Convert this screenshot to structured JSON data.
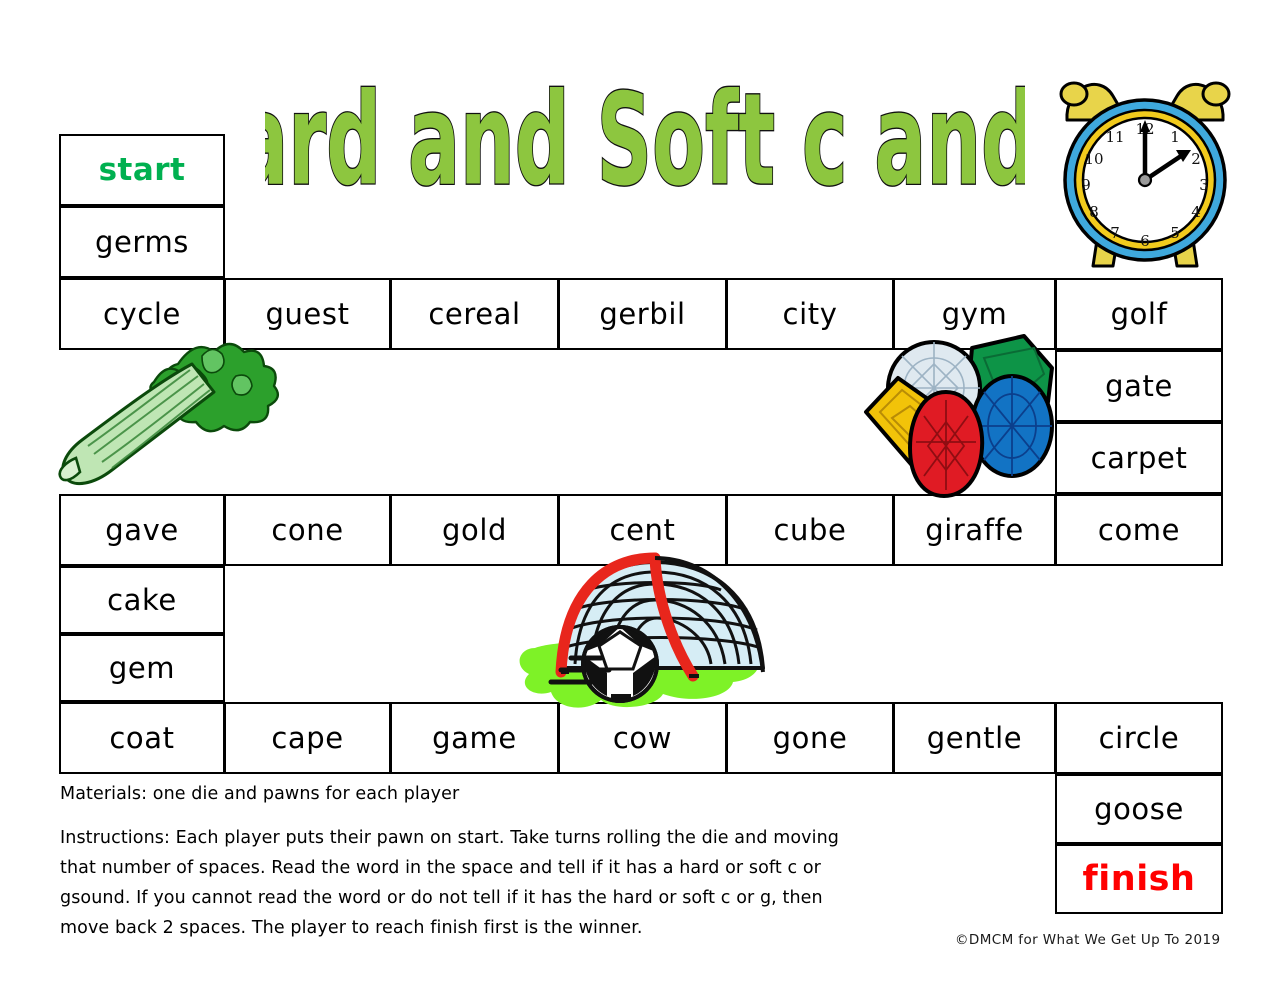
{
  "page": {
    "title": "Hard and Soft c and g",
    "title_color": "#8dc63f",
    "background": "#ffffff"
  },
  "board": {
    "start_cell": {
      "label": "start",
      "color": "#00b050"
    },
    "finish_cell": {
      "label": "finish",
      "color": "#ff0000"
    },
    "left_column_top": [
      {
        "label": "germs"
      }
    ],
    "row_top": [
      {
        "label": "cycle"
      },
      {
        "label": "guest"
      },
      {
        "label": "cereal"
      },
      {
        "label": "gerbil"
      },
      {
        "label": "city"
      },
      {
        "label": "gym"
      },
      {
        "label": "golf"
      }
    ],
    "right_column_upper": [
      {
        "label": "gate"
      },
      {
        "label": "carpet"
      }
    ],
    "row_middle": [
      {
        "label": "gave"
      },
      {
        "label": "cone"
      },
      {
        "label": "gold"
      },
      {
        "label": "cent"
      },
      {
        "label": "cube"
      },
      {
        "label": "giraffe"
      },
      {
        "label": "come"
      }
    ],
    "left_column_lower": [
      {
        "label": "cake"
      },
      {
        "label": "gem"
      }
    ],
    "row_bottom": [
      {
        "label": "coat"
      },
      {
        "label": "cape"
      },
      {
        "label": "game"
      },
      {
        "label": "cow"
      },
      {
        "label": "gone"
      },
      {
        "label": "gentle"
      },
      {
        "label": "circle"
      }
    ],
    "right_column_lower": [
      {
        "label": "goose"
      }
    ]
  },
  "illustrations": {
    "clock": {
      "name": "alarm-clock",
      "numbers": [
        "12",
        "1",
        "2",
        "3",
        "4",
        "5",
        "6",
        "7",
        "8",
        "9",
        "10",
        "11"
      ],
      "hour_hand_points_to": "2",
      "minute_hand_points_to": "12",
      "bell_color": "#e8d44a",
      "ring_color": "#3fa9dd",
      "inner_ring_color": "#f2cb1d",
      "face_color": "#ffffff"
    },
    "celery": {
      "name": "celery",
      "stalk_color": "#bfe6b4",
      "leaf_color": "#2ca02c"
    },
    "gems": {
      "name": "gems",
      "stones": [
        {
          "shape": "round",
          "color": "#dfe9f0"
        },
        {
          "shape": "emerald-cut",
          "color": "#0d9447"
        },
        {
          "shape": "oval",
          "color": "#1273c4"
        },
        {
          "shape": "rectangle",
          "color": "#f2c309"
        },
        {
          "shape": "pear",
          "color": "#e01b24"
        }
      ]
    },
    "soccer": {
      "name": "soccer-goal-and-ball",
      "frame_color": "#e8261c",
      "net_color": "#d6edf5",
      "grass_color": "#7ef227",
      "ball_colors": [
        "#ffffff",
        "#000000"
      ]
    }
  },
  "materials": {
    "text": "Materials: one die and pawns for each player"
  },
  "instructions": {
    "text": "Instructions: Each player puts their pawn on start. Take turns rolling the die and moving that number of spaces. Read the word in the space and tell if it has a hard or soft c or gsound. If you cannot read the word or do not tell if it has the hard or soft c or g, then move back 2 spaces. The player to reach finish first is the winner."
  },
  "credit": {
    "text": "©DMCM for What We Get Up To 2019"
  }
}
